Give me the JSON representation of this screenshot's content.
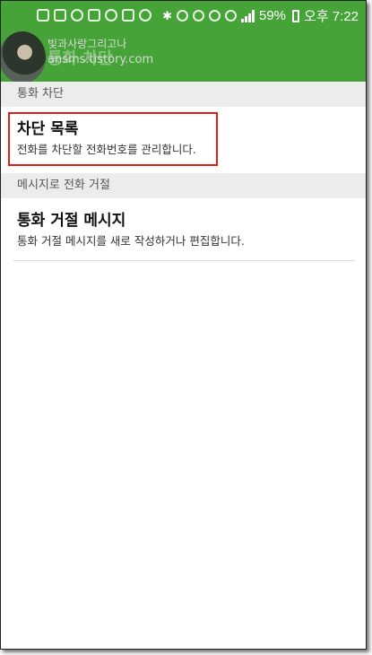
{
  "status_bar": {
    "battery": "59%",
    "time": "오후 7:22"
  },
  "app_bar": {
    "title": "통화 차단"
  },
  "watermark": {
    "line1": "빛과사랑그리고나",
    "line2": "ansms.tistory.com"
  },
  "sections": [
    {
      "header": "통화 차단",
      "items": [
        {
          "title": "차단 목록",
          "summary": "전화를 차단할 전화번호를 관리합니다."
        }
      ]
    },
    {
      "header": "메시지로 전화 거절",
      "items": [
        {
          "title": "통화 거절 메시지",
          "summary": "통화 거절 메시지를 새로 작성하거나 편집합니다."
        }
      ]
    }
  ],
  "colors": {
    "accent": "#46a338",
    "highlight_box": "#e21b1b",
    "section_bg": "#ececec"
  }
}
